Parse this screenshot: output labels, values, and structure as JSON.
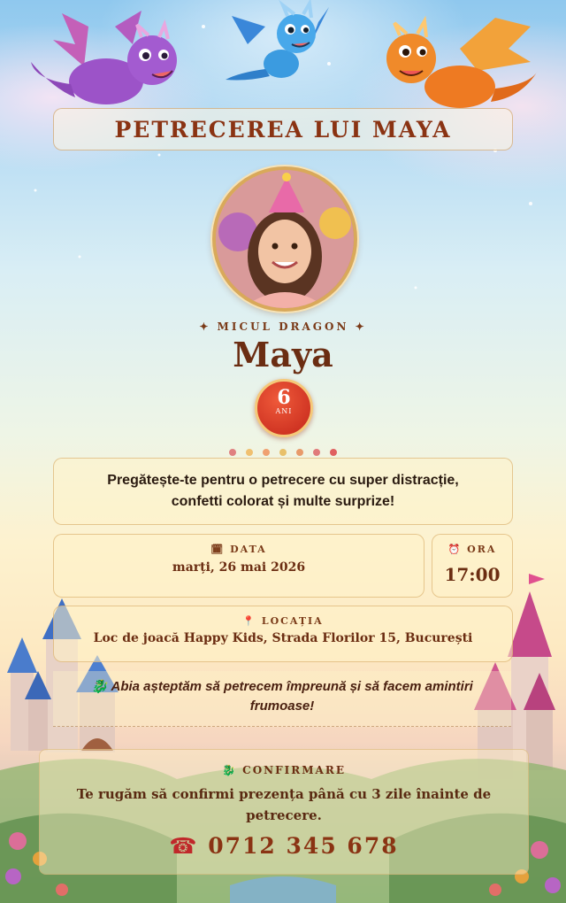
{
  "header": {
    "title": "PETRECEREA LUI MAYA"
  },
  "celebrant": {
    "subtitle": "✦ MICUL DRAGON ✦",
    "name": "Maya",
    "age": "6",
    "age_unit": "ANI"
  },
  "dots_colors": [
    "#e08080",
    "#f0c070",
    "#f0a070",
    "#e8c06a",
    "#e89a6a",
    "#e07a7a",
    "#e06060"
  ],
  "message": {
    "line1": "Pregătește-te pentru o petrecere cu super distracție,",
    "line2": "confetti colorat și multe surprize!"
  },
  "date": {
    "icon": "calendar-icon",
    "label": "DATA",
    "value": "marți, 26 mai 2026"
  },
  "time": {
    "icon": "alarm-clock-icon",
    "label": "ORA",
    "value": "17:00"
  },
  "location": {
    "icon": "pin-icon",
    "label": "LOCAȚIA",
    "value": "Loc de joacă Happy Kids, Strada Florilor 15, București"
  },
  "wish": {
    "icon": "dragon-icon",
    "line1": "Abia așteptăm să petrecem împreună și să facem amintiri",
    "line2": "frumoase!"
  },
  "rsvp": {
    "icon": "dragon-icon",
    "label": "CONFIRMARE",
    "text": "Te rugăm să confirmi prezența până cu 3 zile înainte de petrecere.",
    "phone_icon": "telephone-icon",
    "phone": "0712 345 678"
  }
}
